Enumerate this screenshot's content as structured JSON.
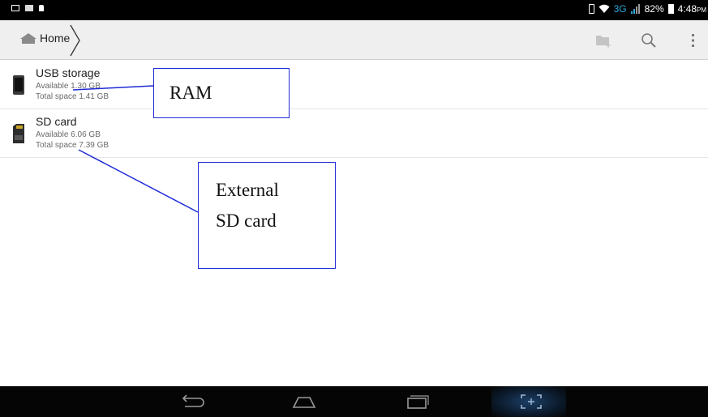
{
  "status_bar": {
    "network": "3G",
    "battery": "82%",
    "time": "4:48",
    "time_suffix": "PM"
  },
  "action_bar": {
    "breadcrumb_home": "Home"
  },
  "storage": [
    {
      "title": "USB storage",
      "available": "Available 1.30 GB",
      "total": "Total space 1.41 GB"
    },
    {
      "title": "SD card",
      "available": "Available 6.06 GB",
      "total": "Total space 7.39 GB"
    }
  ],
  "annotations": {
    "ram": "RAM",
    "sd_line1": "External",
    "sd_line2": "SD card",
    "box_color": "#1f2bd8"
  },
  "colors": {
    "status_bar_bg": "#000000",
    "action_bar_bg": "#efefef",
    "network_accent": "#33a8df",
    "nav_bar_bg": "#050505"
  }
}
